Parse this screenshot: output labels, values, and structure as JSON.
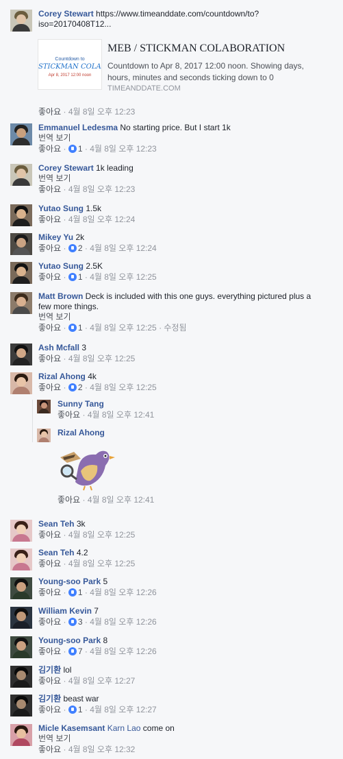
{
  "app": {
    "accent": "#365899",
    "like_color": "#4080ff"
  },
  "post_comment": {
    "name": "Corey Stewart",
    "text_line1": "https://www.timeanddate.com/countdown/to?",
    "text_line2": "iso=20170408T12...",
    "link": {
      "thumb_line1": "Countdown to",
      "thumb_line2": "STICKMAN COLABORA",
      "thumb_line3": "Apr 8, 2017 12:00 noon",
      "title": "MEB / STICKMAN COLABORATION",
      "description": "Countdown to Apr 8, 2017 12:00 noon. Showing days, hours, minutes and seconds ticking down to 0",
      "domain": "TIMEANDDATE.COM"
    },
    "like": "좋아요",
    "time": "4월 8일 오후 12:23"
  },
  "comments": [
    {
      "name": "Emmanuel Ledesma",
      "text": "No starting price. But I start 1k",
      "translate": "번역 보기",
      "like": "좋아요",
      "count": "1",
      "time": "4월 8일 오후 12:23"
    },
    {
      "name": "Corey Stewart",
      "text": "1k leading",
      "translate": "번역 보기",
      "like": "좋아요",
      "time": "4월 8일 오후 12:23"
    },
    {
      "name": "Yutao Sung",
      "text": "1.5k",
      "like": "좋아요",
      "time": "4월 8일 오후 12:24"
    },
    {
      "name": "Mikey Yu",
      "text": "2k",
      "like": "좋아요",
      "count": "2",
      "time": "4월 8일 오후 12:24"
    },
    {
      "name": "Yutao Sung",
      "text": "2.5K",
      "like": "좋아요",
      "count": "1",
      "time": "4월 8일 오후 12:25"
    },
    {
      "name": "Matt Brown",
      "text_line1": "Deck is included with this one guys. everything pictured plus a",
      "text_line2": "few more things.",
      "translate": "번역 보기",
      "like": "좋아요",
      "count": "1",
      "time": "4월 8일 오후 12:25",
      "edited": "수정됨"
    },
    {
      "name": "Ash Mcfall",
      "text": "3",
      "like": "좋아요",
      "time": "4월 8일 오후 12:25"
    },
    {
      "name": "Rizal Ahong",
      "text": "4k",
      "like": "좋아요",
      "count": "2",
      "time": "4월 8일 오후 12:25"
    }
  ],
  "replies": [
    {
      "name": "Sunny Tang",
      "like": "좋아요",
      "time": "4월 8일 오후 12:41"
    },
    {
      "name": "Rizal Ahong",
      "like": "좋아요",
      "time": "4월 8일 오후 12:41"
    }
  ],
  "comments2": [
    {
      "name": "Sean Teh",
      "text": "3k",
      "like": "좋아요",
      "time": "4월 8일 오후 12:25"
    },
    {
      "name": "Sean Teh",
      "text": "4.2",
      "like": "좋아요",
      "time": "4월 8일 오후 12:25"
    },
    {
      "name": "Young-soo Park",
      "text": "5",
      "like": "좋아요",
      "count": "1",
      "time": "4월 8일 오후 12:26"
    },
    {
      "name": "William Kevin",
      "text": "7",
      "like": "좋아요",
      "count": "3",
      "time": "4월 8일 오후 12:26"
    },
    {
      "name": "Young-soo Park",
      "text": "8",
      "like": "좋아요",
      "count": "7",
      "time": "4월 8일 오후 12:26"
    },
    {
      "name": "김기환",
      "text": "lol",
      "like": "좋아요",
      "time": "4월 8일 오후 12:27"
    },
    {
      "name": "김기환",
      "text": "beast war",
      "like": "좋아요",
      "count": "1",
      "time": "4월 8일 오후 12:27"
    },
    {
      "name": "Micle Kasemsant",
      "mention": "Karn Lao",
      "text": "come on",
      "translate": "번역 보기",
      "like": "좋아요",
      "time": "4월 8일 오후 12:32"
    }
  ]
}
